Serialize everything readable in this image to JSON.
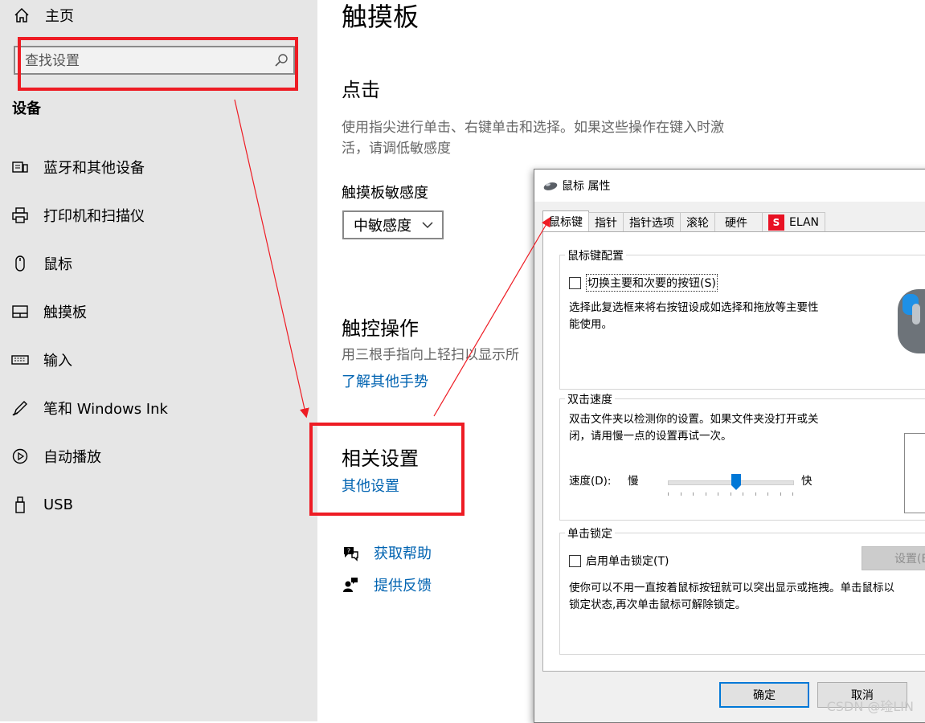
{
  "sidebar": {
    "home_label": "主页",
    "search_placeholder": "查找设置",
    "section_title": "设备",
    "items": [
      {
        "label": "蓝牙和其他设备",
        "icon": "bluetooth-devices-icon"
      },
      {
        "label": "打印机和扫描仪",
        "icon": "printer-icon"
      },
      {
        "label": "鼠标",
        "icon": "mouse-icon"
      },
      {
        "label": "触摸板",
        "icon": "touchpad-icon"
      },
      {
        "label": "输入",
        "icon": "keyboard-icon"
      },
      {
        "label": "笔和 Windows Ink",
        "icon": "pen-icon"
      },
      {
        "label": "自动播放",
        "icon": "autoplay-icon"
      },
      {
        "label": "USB",
        "icon": "usb-icon"
      }
    ]
  },
  "main": {
    "title": "触摸板",
    "tap_heading": "点击",
    "tap_desc_line1": "使用指尖进行单击、右键单击和选择。如果这些操作在键入时激",
    "tap_desc_line2": "活，请调低敏感度",
    "sensitivity_label": "触摸板敏感度",
    "sensitivity_value": "中敏感度",
    "gesture_heading": "触控操作",
    "gesture_desc": "用三根手指向上轻扫以显示所",
    "gesture_link": "了解其他手势",
    "related_heading": "相关设置",
    "related_link": "其他设置",
    "help_label": "获取帮助",
    "feedback_label": "提供反馈"
  },
  "dialog": {
    "title": "鼠标 属性",
    "tabs": [
      "鼠标键",
      "指针",
      "指针选项",
      "滚轮",
      "硬件",
      "ELAN"
    ],
    "button_config": {
      "title": "鼠标键配置",
      "checkbox_label": "切换主要和次要的按钮(S)",
      "desc_line1": "选择此复选框来将右按钮设成如选择和拖放等主要性",
      "desc_line2": "能使用。"
    },
    "double_click": {
      "title": "双击速度",
      "desc_line1": "双击文件夹以检测你的设置。如果文件夹没打开或关",
      "desc_line2": "闭，请用慢一点的设置再试一次。",
      "speed_label": "速度(D):",
      "slow_label": "慢",
      "fast_label": "快",
      "speed_value": 0.55
    },
    "click_lock": {
      "title": "单击锁定",
      "checkbox_label": "启用单击锁定(T)",
      "settings_button": "设置(E)",
      "desc_line1": "使你可以不用一直按着鼠标按钮就可以突出显示或拖拽。单击鼠标以",
      "desc_line2": "锁定状态,再次单击鼠标可解除锁定。"
    },
    "ok_button": "确定",
    "cancel_button": "取消"
  },
  "watermark": "CSDN @琻LIN",
  "colors": {
    "annotation_red": "#ee1c24",
    "link_blue": "#0063b1",
    "sidebar_bg": "#e6e6e6",
    "accent": "#0078d7"
  }
}
